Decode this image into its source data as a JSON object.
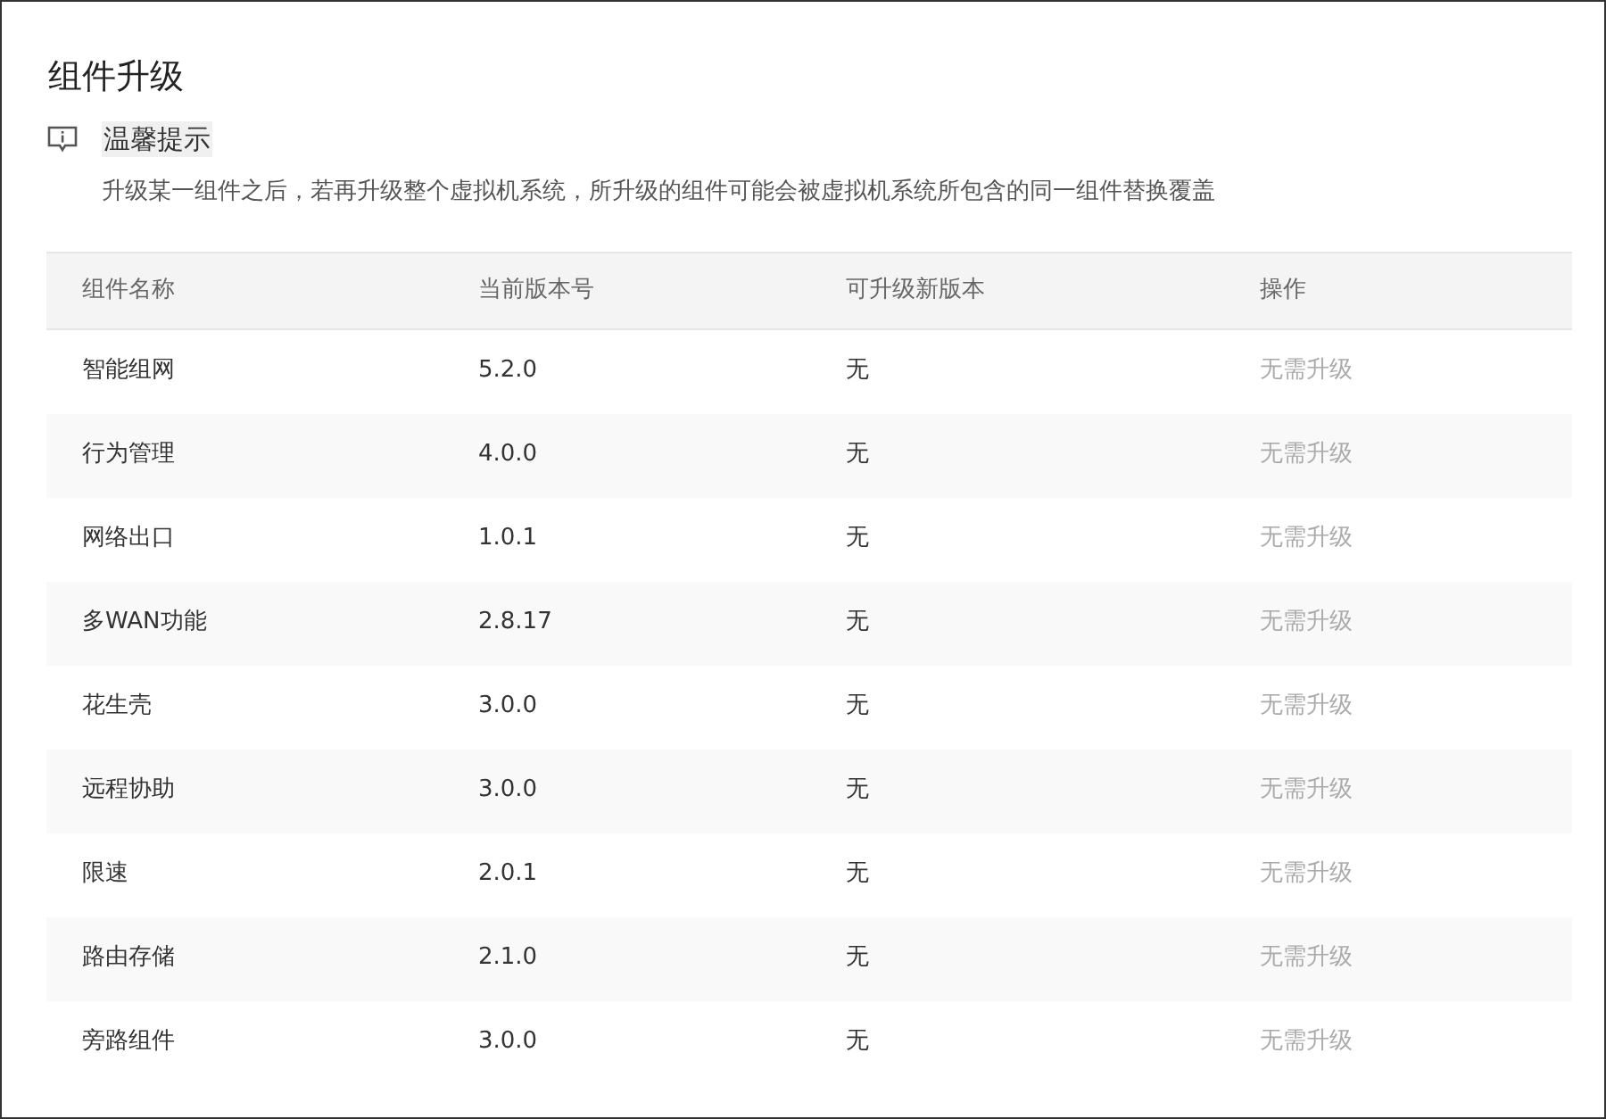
{
  "title": "组件升级",
  "notice": {
    "title": "温馨提示",
    "text": "升级某一组件之后，若再升级整个虚拟机系统，所升级的组件可能会被虚拟机系统所包含的同一组件替换覆盖"
  },
  "table": {
    "columns": [
      "组件名称",
      "当前版本号",
      "可升级新版本",
      "操作"
    ],
    "rows": [
      {
        "name": "智能组网",
        "version": "5.2.0",
        "new_version": "无",
        "action": {
          "label": "无需升级",
          "disabled": true
        }
      },
      {
        "name": "行为管理",
        "version": "4.0.0",
        "new_version": "无",
        "action": {
          "label": "无需升级",
          "disabled": true
        }
      },
      {
        "name": "网络出口",
        "version": "1.0.1",
        "new_version": "无",
        "action": {
          "label": "无需升级",
          "disabled": true
        }
      },
      {
        "name": "多WAN功能",
        "version": "2.8.17",
        "new_version": "无",
        "action": {
          "label": "无需升级",
          "disabled": true
        }
      },
      {
        "name": "花生壳",
        "version": "3.0.0",
        "new_version": "无",
        "action": {
          "label": "无需升级",
          "disabled": true
        }
      },
      {
        "name": "远程协助",
        "version": "3.0.0",
        "new_version": "无",
        "action": {
          "label": "无需升级",
          "disabled": true
        }
      },
      {
        "name": "限速",
        "version": "2.0.1",
        "new_version": "无",
        "action": {
          "label": "无需升级",
          "disabled": true
        }
      },
      {
        "name": "路由存储",
        "version": "2.1.0",
        "new_version": "无",
        "action": {
          "label": "无需升级",
          "disabled": true
        }
      },
      {
        "name": "旁路组件",
        "version": "3.0.0",
        "new_version": "无",
        "action": {
          "label": "无需升级",
          "disabled": true
        }
      }
    ]
  }
}
